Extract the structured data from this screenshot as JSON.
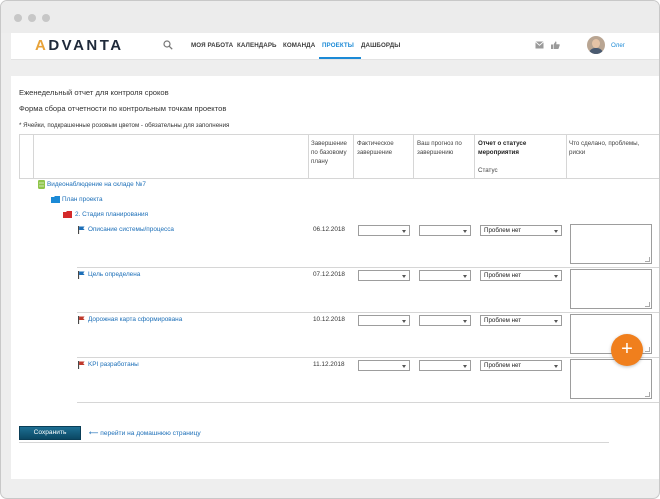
{
  "navbar": {
    "logo": "ADVANTA",
    "items": [
      {
        "label": "МОЯ РАБОТА"
      },
      {
        "label": "КАЛЕНДАРЬ"
      },
      {
        "label": "КОМАНДА"
      },
      {
        "label": "ПРОЕКТЫ",
        "active": true
      },
      {
        "label": "ДАШБОРДЫ"
      }
    ],
    "user_name": "Олег",
    "accent_color": "#1c8ad6"
  },
  "page": {
    "report_title": "Еженедельный отчет для контроля сроков",
    "form_title": "Форма сбора отчетности по контрольным точкам проектов",
    "required_note": "* Ячейки, подкрашенные розовым цветом - обязательны для заполнения"
  },
  "table": {
    "headers": {
      "planned": "Завершение по базовому плану",
      "actual": "Фактическое завершение",
      "forecast": "Ваш прогноз по завершению",
      "status_title": "Отчет о статусе мероприятия",
      "status_sub": "Статус",
      "problems": "Что сделано, проблемы, риски"
    },
    "tree": {
      "project": "Видеонаблюдение на складе №7",
      "plan": "План проекта",
      "stage": "2. Стадия планирования"
    },
    "rows": [
      {
        "name": "Описание системы/процесса",
        "date": "06.12.2018",
        "status": "Проблем нет",
        "flag_color": "#1c6fb8"
      },
      {
        "name": "Цель определена",
        "date": "07.12.2018",
        "status": "Проблем нет",
        "flag_color": "#1c6fb8"
      },
      {
        "name": "Дорожная карта сформирована",
        "date": "10.12.2018",
        "status": "Проблем нет",
        "flag_color": "#c0392b"
      },
      {
        "name": "KPI разработаны",
        "date": "11.12.2018",
        "status": "Проблем нет",
        "flag_color": "#c0392b"
      }
    ]
  },
  "footer": {
    "save_label": "Сохранить",
    "home_link": "перейти на домашнюю страницу",
    "fab_label": "+"
  }
}
